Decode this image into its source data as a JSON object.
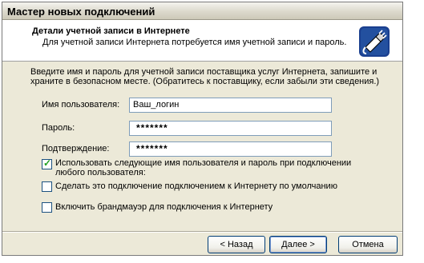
{
  "window": {
    "title": "Мастер новых подключений"
  },
  "header": {
    "title": "Детали учетной записи в Интернете",
    "subtitle": "Для учетной записи Интернета потребуется имя учетной записи и пароль.",
    "icon": "network-cable-icon"
  },
  "intro": "Введите имя и пароль для учетной записи поставщика услуг Интернета, запишите и храните в безопасном месте. (Обратитесь к поставщику, если забыли эти сведения.)",
  "fields": {
    "username": {
      "label": "Имя пользователя:",
      "value": "Ваш_логин"
    },
    "password": {
      "label": "Пароль:",
      "value": "*******"
    },
    "confirm": {
      "label": "Подтверждение:",
      "value": "*******"
    }
  },
  "checkboxes": [
    {
      "label": "Использовать следующие имя пользователя и пароль при подключении любого пользователя:",
      "checked": true
    },
    {
      "label": "Сделать это подключение подключением к Интернету по умолчанию",
      "checked": false
    },
    {
      "label": "Включить брандмауэр для подключения к Интернету",
      "checked": false
    }
  ],
  "buttons": {
    "back": "< Назад",
    "next": "Далее >",
    "cancel": "Отмена"
  }
}
